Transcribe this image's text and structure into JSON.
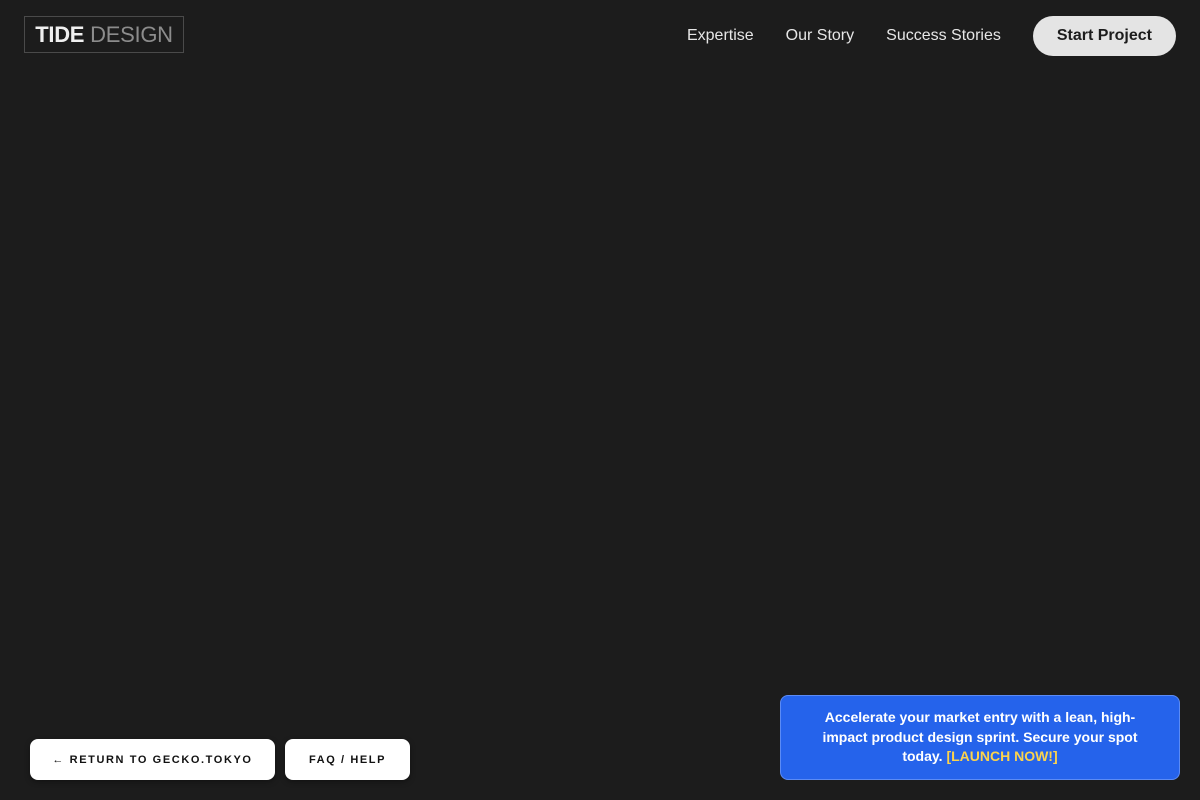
{
  "brand": {
    "name_strong": "TIDE",
    "name_light": "DESIGN"
  },
  "nav": {
    "links": [
      "Expertise",
      "Our Story",
      "Success Stories"
    ],
    "cta_label": "Start Project"
  },
  "footer_buttons": {
    "return_label": "← RETURN TO GECKO.TOKYO",
    "faq_label": "FAQ / HELP"
  },
  "promo": {
    "text": "Accelerate your market entry with a lean, high-impact product design sprint. Secure your spot today.",
    "link_label": "[LAUNCH NOW!]"
  },
  "colors": {
    "background": "#1c1c1c",
    "promo_bg": "#2563eb",
    "promo_link": "#fcd34d",
    "cta_bg": "#e4e4e4"
  }
}
